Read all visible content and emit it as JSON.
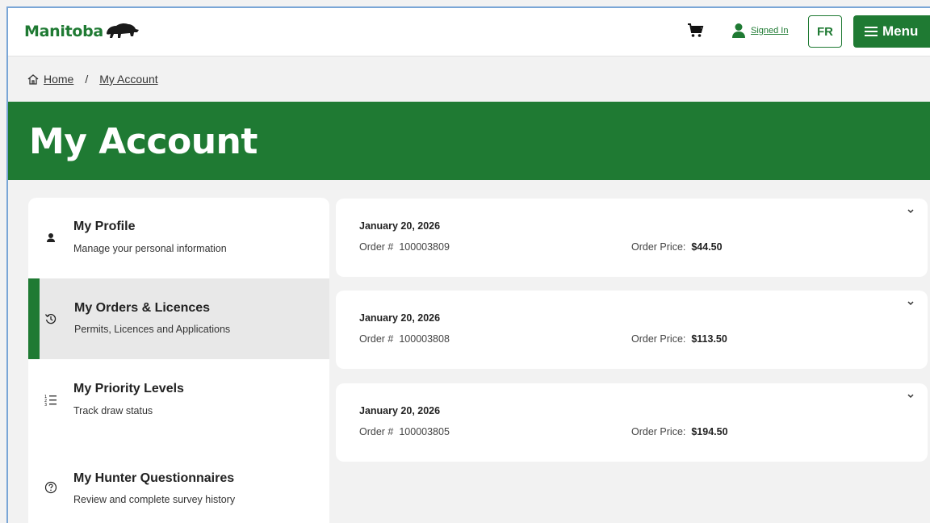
{
  "header": {
    "logo_text": "Manitoba",
    "signed_in_label": "Signed In",
    "lang_button": "FR",
    "menu_label": "Menu"
  },
  "breadcrumb": {
    "home": "Home",
    "separator": "/",
    "current": "My Account"
  },
  "page_title": "My Account",
  "sidebar": {
    "items": [
      {
        "title": "My Profile",
        "subtitle": "Manage your personal information",
        "icon": "person-icon",
        "active": false
      },
      {
        "title": "My Orders & Licences",
        "subtitle": "Permits, Licences and Applications",
        "icon": "history-icon",
        "active": true
      },
      {
        "title": "My Priority Levels",
        "subtitle": "Track draw status",
        "icon": "ordered-list-icon",
        "active": false
      },
      {
        "title": "My Hunter Questionnaires",
        "subtitle": "Review and complete survey history",
        "icon": "question-circle-icon",
        "active": false
      }
    ]
  },
  "orders": [
    {
      "date": "January 20, 2026",
      "order_label": "Order #",
      "order_number": "100003809",
      "price_label": "Order Price:",
      "price": "$44.50"
    },
    {
      "date": "January 20, 2026",
      "order_label": "Order #",
      "order_number": "100003808",
      "price_label": "Order Price:",
      "price": "$113.50"
    },
    {
      "date": "January 20, 2026",
      "order_label": "Order #",
      "order_number": "100003805",
      "price_label": "Order Price:",
      "price": "$194.50"
    }
  ],
  "colors": {
    "brand_green": "#1f7a33",
    "background": "#f2f2f2",
    "active_item_bg": "#e8e8e8"
  }
}
